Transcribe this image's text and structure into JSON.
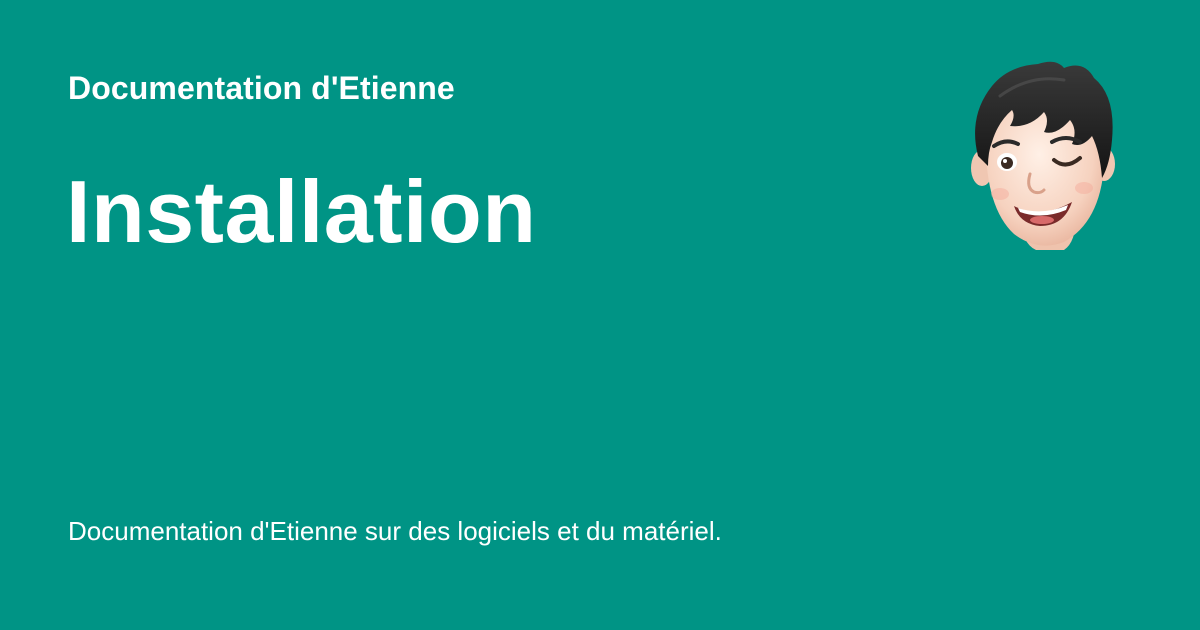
{
  "colors": {
    "background": "#009485",
    "text": "#ffffff"
  },
  "header": {
    "site_name": "Documentation d'Etienne"
  },
  "main": {
    "title": "Installation"
  },
  "footer": {
    "description": "Documentation d'Etienne sur des logiciels et du matériel."
  },
  "avatar": {
    "icon": "winking-memoji-avatar-icon"
  }
}
